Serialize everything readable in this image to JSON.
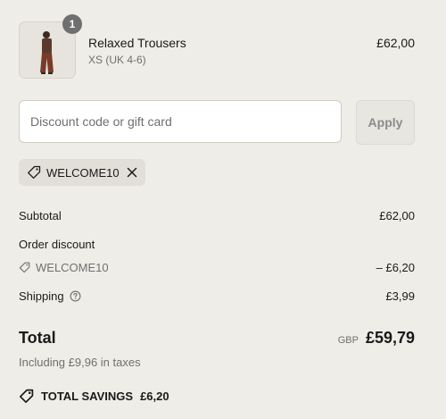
{
  "product": {
    "quantity": "1",
    "name": "Relaxed Trousers",
    "variant": "XS (UK 4-6)",
    "price": "£62,00"
  },
  "discount": {
    "placeholder": "Discount code or gift card",
    "value": "",
    "apply_label": "Apply",
    "applied_code": "WELCOME10"
  },
  "summary": {
    "subtotal_label": "Subtotal",
    "subtotal_value": "£62,00",
    "order_discount_label": "Order discount",
    "discount_code": "WELCOME10",
    "discount_value": "– £6,20",
    "shipping_label": "Shipping",
    "shipping_value": "£3,99"
  },
  "total": {
    "label": "Total",
    "currency": "GBP",
    "amount": "£59,79",
    "taxes_note": "Including £9,96 in taxes"
  },
  "savings": {
    "label": "TOTAL SAVINGS",
    "amount": "£6,20"
  },
  "icons": {
    "tag": "tag-icon",
    "close": "close-icon",
    "help": "question-circle-icon",
    "savings": "tag-icon"
  },
  "colors": {
    "background": "#eeede7",
    "badge": "#6f6f6f",
    "muted_text": "#707070"
  }
}
